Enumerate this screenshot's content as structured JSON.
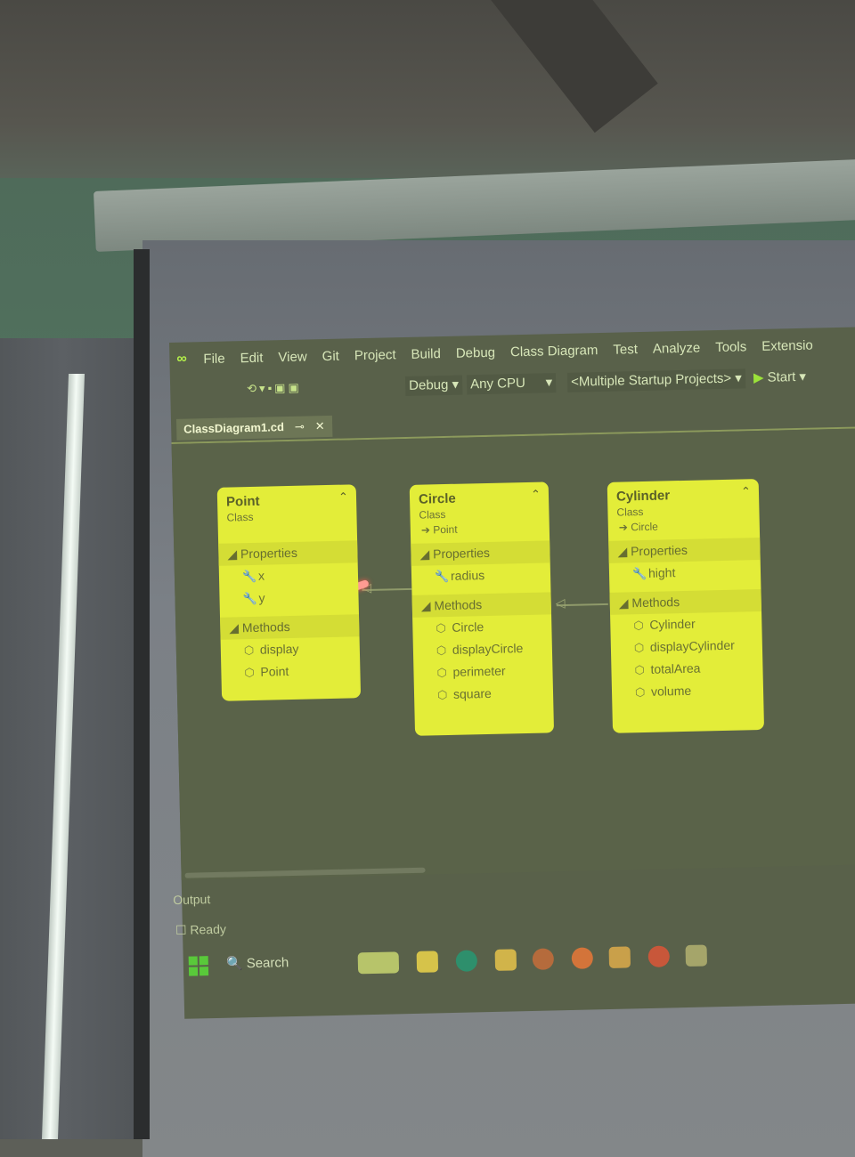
{
  "ide": {
    "menu": [
      "File",
      "Edit",
      "View",
      "Git",
      "Project",
      "Build",
      "Debug",
      "Class Diagram",
      "Test",
      "Analyze",
      "Tools",
      "Extensio"
    ],
    "toolbar": {
      "configuration": "Debug",
      "platform": "Any CPU",
      "startup": "<Multiple Startup Projects>",
      "start_label": "Start"
    },
    "tab": {
      "title": "ClassDiagram1.cd",
      "pin": "⊸",
      "close": "✕"
    },
    "classes": [
      {
        "name": "Point",
        "kind": "Class",
        "base": "",
        "properties": [
          {
            "name": "x"
          },
          {
            "name": "y"
          }
        ],
        "methods": [
          {
            "name": "display"
          },
          {
            "name": "Point"
          }
        ]
      },
      {
        "name": "Circle",
        "kind": "Class",
        "base": "Point",
        "properties": [
          {
            "name": "radius"
          }
        ],
        "methods": [
          {
            "name": "Circle"
          },
          {
            "name": "displayCircle"
          },
          {
            "name": "perimeter"
          },
          {
            "name": "square"
          }
        ]
      },
      {
        "name": "Cylinder",
        "kind": "Class",
        "base": "Circle",
        "properties": [
          {
            "name": "hight"
          }
        ],
        "methods": [
          {
            "name": "Cylinder"
          },
          {
            "name": "displayCylinder"
          },
          {
            "name": "totalArea"
          },
          {
            "name": "volume"
          }
        ]
      }
    ],
    "labels": {
      "properties": "Properties",
      "methods": "Methods"
    },
    "output_label": "Output",
    "status": "Ready",
    "taskbar": {
      "search": "Search"
    },
    "colors": {
      "class_box": "#e3ed39",
      "accent": "#b4f04a"
    }
  }
}
